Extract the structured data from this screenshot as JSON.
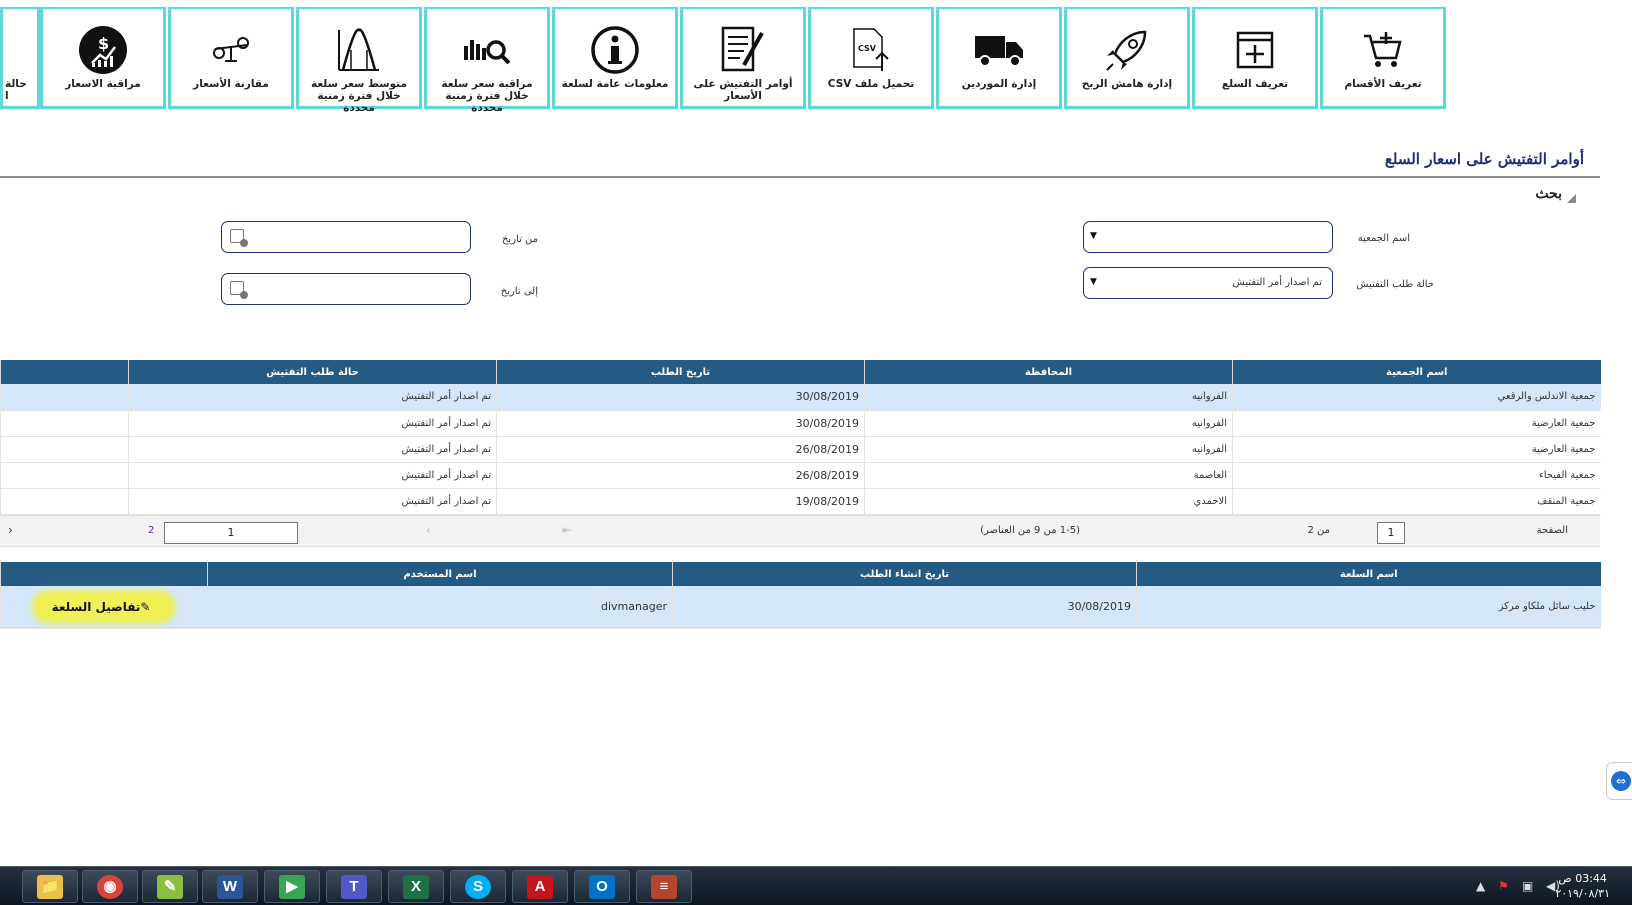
{
  "toolbar": {
    "items": [
      {
        "label": "حالة ا",
        "icon": "status-icon"
      },
      {
        "label": "مراقبة الاسعار",
        "icon": "price-monitor-icon"
      },
      {
        "label": "مقارنة الأسعار",
        "icon": "scale-compare-icon"
      },
      {
        "label": "متوسط سعر سلعة خلال فترة زمنية محددة",
        "icon": "bell-curve-icon"
      },
      {
        "label": "مراقبة سعر سلعة خلال فترة زمنية محددة",
        "icon": "chart-search-icon"
      },
      {
        "label": "معلومات عامة لسلعة",
        "icon": "info-icon"
      },
      {
        "label": "أوامر التفتيش على الأسعار",
        "icon": "document-edit-icon"
      },
      {
        "label": "تحميل ملف CSV",
        "icon": "csv-upload-icon"
      },
      {
        "label": "إدارة الموردين",
        "icon": "truck-icon"
      },
      {
        "label": "إدارة هامش الربح",
        "icon": "rocket-icon"
      },
      {
        "label": "تعريف السلع",
        "icon": "add-window-icon"
      },
      {
        "label": "تعريف الأقسام",
        "icon": "cart-add-icon"
      }
    ]
  },
  "page": {
    "title": "أوامر التفتيش على اسعار السلع",
    "search_heading": "بحث"
  },
  "form": {
    "society_label": "اسم الجمعية",
    "society_value": "",
    "status_label": "حالة طلب التفتيش",
    "status_value": "تم اصدار أمر التفتيش",
    "from_label": "من تاريخ",
    "to_label": "إلى تاريخ",
    "dropdown_glyph": "▼"
  },
  "orders_table": {
    "headers": [
      "اسم الجمعية",
      "المحافظة",
      "تاريخ الطلب",
      "حالة طلب التفتيش"
    ],
    "rows": [
      [
        "جمعية الاندلس والرقعي",
        "الفروانيه",
        "30/08/2019",
        "تم اصدار أمر التفتيش"
      ],
      [
        "جمعية العارضية",
        "الفروانيه",
        "30/08/2019",
        "تم اصدار أمر التفتيش"
      ],
      [
        "جمعية العارضية",
        "الفروانيه",
        "26/08/2019",
        "تم اصدار أمر التفتيش"
      ],
      [
        "جمعية الفيحاء",
        "العاصمة",
        "26/08/2019",
        "تم اصدار أمر التفتيش"
      ],
      [
        "جمعية المنقف",
        "الاحمدي",
        "19/08/2019",
        "تم اصدار أمر التفتيش"
      ]
    ]
  },
  "pager": {
    "page_label": "الصفحة",
    "current_page_left": "1",
    "of_label": "من 2",
    "items_info": "(1-5 من 9 من العناصر)",
    "current_page": "1",
    "next_page": "2",
    "first_glyph": "⇤",
    "prev_glyph": "‹",
    "next_glyph": "›"
  },
  "items_table": {
    "headers": [
      "اسم السلعة",
      "تاريخ انشاء الطلب",
      "اسم المستخدم",
      ""
    ],
    "rows": [
      {
        "item": "حليب سائل ملكاو مركز",
        "date": "30/08/2019",
        "user": "divmanager",
        "action": "تفاصيل السلعة"
      }
    ]
  },
  "taskbar": {
    "apps": [
      {
        "name": "explorer",
        "glyph": "📁",
        "color": "#e9c04a"
      },
      {
        "name": "chrome",
        "glyph": "◉",
        "color": "#d9443a"
      },
      {
        "name": "notepad",
        "glyph": "✎",
        "color": "#8cbf3f"
      },
      {
        "name": "word",
        "glyph": "W",
        "color": "#2a5699"
      },
      {
        "name": "media",
        "glyph": "▶",
        "color": "#3aa655"
      },
      {
        "name": "teams",
        "glyph": "T",
        "color": "#5059c9"
      },
      {
        "name": "excel",
        "glyph": "X",
        "color": "#1e7145"
      },
      {
        "name": "skype",
        "glyph": "S",
        "color": "#00aff0"
      },
      {
        "name": "acrobat",
        "glyph": "A",
        "color": "#c4161c"
      },
      {
        "name": "outlook",
        "glyph": "O",
        "color": "#0072c6"
      },
      {
        "name": "app",
        "glyph": "≡",
        "color": "#b5452b"
      }
    ],
    "clock_time": "03:44 ص",
    "clock_date": "٢٠١٩/٠٨/٣١"
  }
}
